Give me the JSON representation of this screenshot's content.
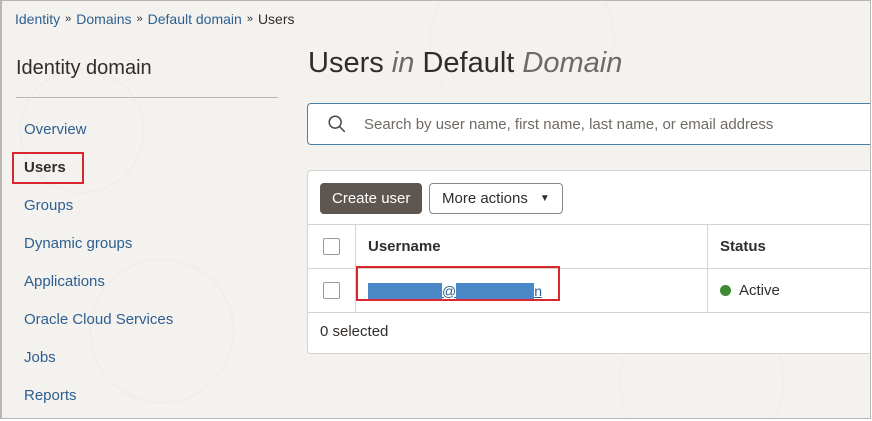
{
  "breadcrumb": {
    "items": [
      "Identity",
      "Domains",
      "Default domain"
    ],
    "current": "Users",
    "separator": "»"
  },
  "sidebar": {
    "title": "Identity domain",
    "items": [
      {
        "label": "Overview",
        "active": false
      },
      {
        "label": "Users",
        "active": true
      },
      {
        "label": "Groups",
        "active": false
      },
      {
        "label": "Dynamic groups",
        "active": false
      },
      {
        "label": "Applications",
        "active": false
      },
      {
        "label": "Oracle Cloud Services",
        "active": false
      },
      {
        "label": "Jobs",
        "active": false
      },
      {
        "label": "Reports",
        "active": false
      }
    ]
  },
  "page": {
    "title_part1": "Users",
    "title_in": "in",
    "title_part2": "Default",
    "title_part3": "Domain"
  },
  "search": {
    "placeholder": "Search by user name, first name, last name, or email address",
    "icon": "search-icon"
  },
  "toolbar": {
    "create_label": "Create user",
    "more_label": "More actions",
    "more_caret": "▼"
  },
  "table": {
    "columns": [
      "Username",
      "Status"
    ],
    "rows": [
      {
        "username_at": "@",
        "username_tail": "n",
        "status": "Active",
        "status_color": "#3f8a32"
      }
    ],
    "selected_text": "0 selected"
  },
  "colors": {
    "link": "#2d5f8f",
    "primary_button": "#5e5650",
    "highlight": "#d9272e",
    "redaction": "#4a88c7"
  }
}
